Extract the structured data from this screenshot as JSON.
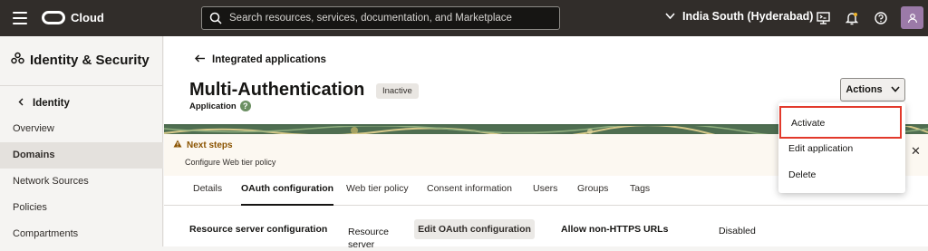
{
  "topbar": {
    "brand": "Cloud",
    "search_placeholder": "Search resources, services, documentation, and Marketplace",
    "region": "India South (Hyderabad)",
    "icons": [
      "menu-icon",
      "oracle-logo",
      "search-icon",
      "chevron-down-icon",
      "cloud-shell-icon",
      "bell-icon",
      "help-icon",
      "user-icon"
    ]
  },
  "sidebar": {
    "title": "Identity & Security",
    "back_label": "Identity",
    "items": [
      {
        "label": "Overview",
        "active": false
      },
      {
        "label": "Domains",
        "active": true
      },
      {
        "label": "Network Sources",
        "active": false
      },
      {
        "label": "Policies",
        "active": false
      },
      {
        "label": "Compartments",
        "active": false
      }
    ]
  },
  "main": {
    "back_link": "Integrated applications",
    "title": "Multi-Authentication",
    "status_badge": "Inactive",
    "subtitle": "Application",
    "help_glyph": "?",
    "actions_label": "Actions",
    "notice": {
      "title": "Next steps",
      "text": "Configure Web tier policy"
    },
    "tabs": [
      {
        "label": "Details",
        "active": false
      },
      {
        "label": "OAuth configuration",
        "active": true
      },
      {
        "label": "Web tier policy",
        "active": false
      },
      {
        "label": "Consent information",
        "active": false
      },
      {
        "label": "Users",
        "active": false
      },
      {
        "label": "Groups",
        "active": false
      },
      {
        "label": "Tags",
        "active": false
      }
    ],
    "section": {
      "label": "Resource server configuration",
      "resource_server_label": "Resource server",
      "edit_button": "Edit OAuth configuration",
      "allow_label": "Allow non-HTTPS URLs",
      "allow_value": "Disabled"
    }
  },
  "actions_menu": {
    "items": [
      "Activate",
      "Edit application",
      "Delete"
    ],
    "highlighted": "Activate",
    "highlight_color": "#e2392b"
  }
}
